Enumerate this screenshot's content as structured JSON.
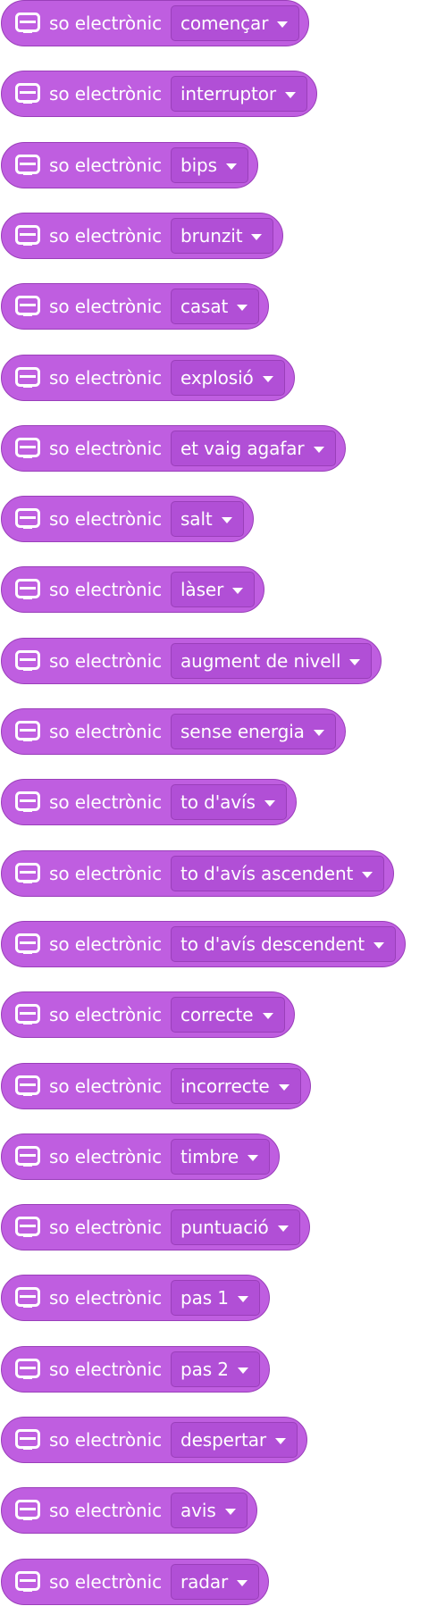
{
  "block_label": "so electrònic",
  "icon": "microbit-icon",
  "colors": {
    "block_fill": "#bf5ee0",
    "block_border": "#9a3fba",
    "dropdown_fill": "#b14fd6",
    "text": "#ffffff"
  },
  "sounds": [
    "començar",
    "interruptor",
    "bips",
    "brunzit",
    "casat",
    "explosió",
    "et vaig agafar",
    "salt",
    "làser",
    "augment de nivell",
    "sense energia",
    "to d'avís",
    "to d'avís ascendent",
    "to d'avís descendent",
    "correcte",
    "incorrecte",
    "timbre",
    "puntuació",
    "pas 1",
    "pas 2",
    "despertar",
    "avis",
    "radar"
  ]
}
